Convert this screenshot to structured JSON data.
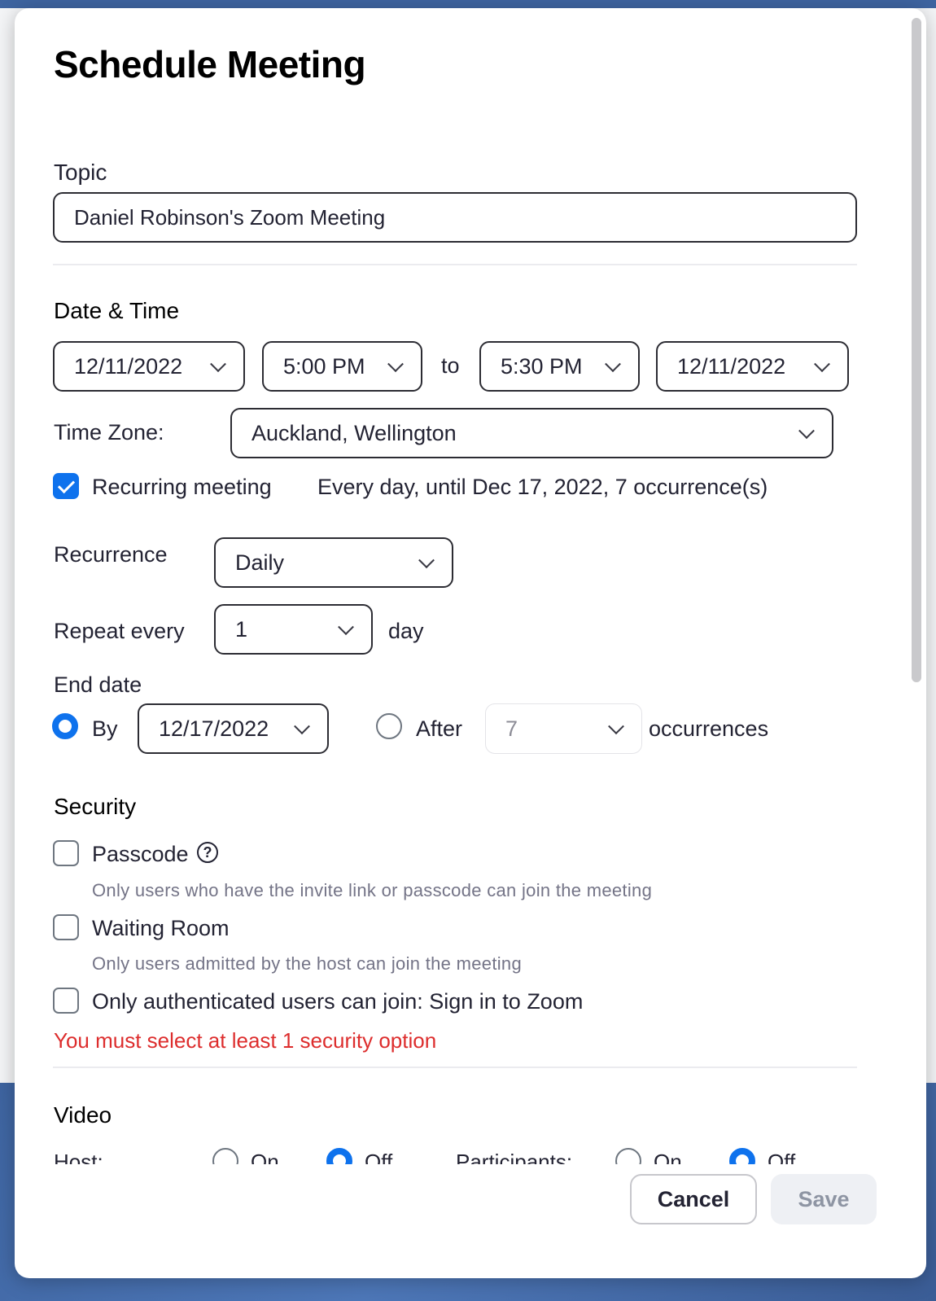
{
  "dialog": {
    "title": "Schedule Meeting"
  },
  "topic": {
    "label": "Topic",
    "value": "Daniel Robinson's Zoom Meeting"
  },
  "datetime": {
    "label": "Date & Time",
    "start_date": "12/11/2022",
    "start_time": "5:00 PM",
    "to_label": "to",
    "end_time": "5:30 PM",
    "end_date": "12/11/2022",
    "timezone_label": "Time Zone:",
    "timezone_value": "Auckland, Wellington"
  },
  "recurring": {
    "checkbox_label": "Recurring meeting",
    "checked": true,
    "summary": "Every day, until Dec 17, 2022, 7 occurrence(s)",
    "recurrence_label": "Recurrence",
    "recurrence_value": "Daily",
    "repeat_label": "Repeat every",
    "repeat_value": "1",
    "repeat_unit": "day",
    "end_date_label": "End date",
    "by_label": "By",
    "by_value": "12/17/2022",
    "after_label": "After",
    "after_value": "7",
    "occurrences_label": "occurrences"
  },
  "security": {
    "label": "Security",
    "passcode_label": "Passcode",
    "passcode_hint": "Only users who have the invite link or passcode can join the meeting",
    "waiting_room_label": "Waiting Room",
    "waiting_room_hint": "Only users admitted by the host can join the meeting",
    "auth_label": "Only authenticated users can join: Sign in to Zoom",
    "error": "You must select at least 1 security option"
  },
  "video": {
    "label": "Video",
    "host_label": "Host:",
    "participants_label": "Participants:",
    "on_label": "On",
    "off_label": "Off"
  },
  "footer": {
    "cancel_label": "Cancel",
    "save_label": "Save"
  },
  "colors": {
    "accent": "#0e72ed",
    "error": "#dd2d2d"
  }
}
